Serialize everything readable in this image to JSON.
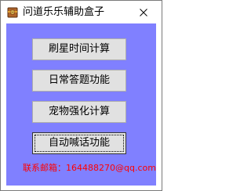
{
  "window": {
    "title": "问道乐乐辅助盒子",
    "app_icon": "treasure-box-icon",
    "close_icon": "close-icon"
  },
  "buttons": [
    {
      "label": "刷星时间计算"
    },
    {
      "label": "日常答题功能"
    },
    {
      "label": "宠物强化计算"
    },
    {
      "label": "自动喊话功能"
    }
  ],
  "contact": {
    "text": "联系邮箱：1644882​70@qq.com"
  },
  "colors": {
    "client_background": "#8080ff",
    "contact_text": "#ff0000",
    "button_face": "#e1e1e1"
  }
}
